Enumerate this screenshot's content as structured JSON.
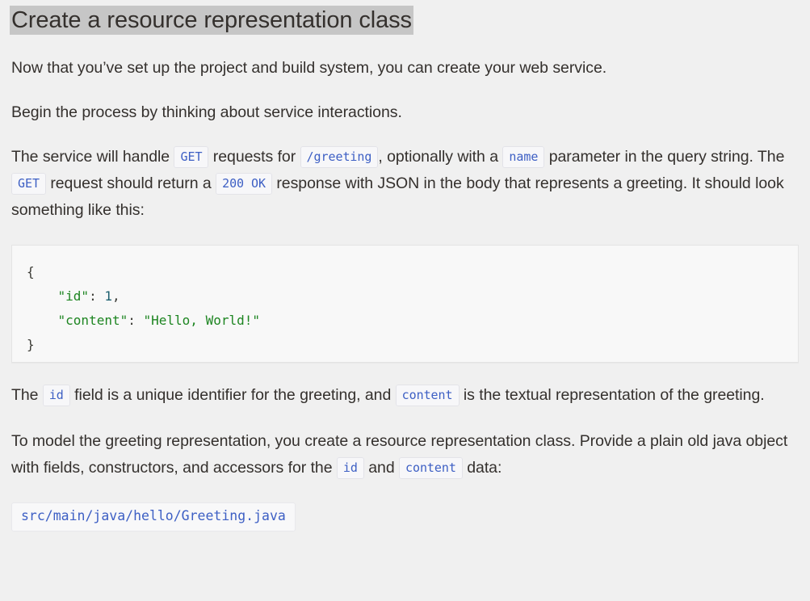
{
  "page": {
    "background_color": "#f0f0f0",
    "title": "Create a resource representation class",
    "title_highlight_color": "#c6c6c6"
  },
  "paragraphs": {
    "p1": "Now that you’ve set up the project and build system, you can create your web service.",
    "p2": "Begin the process by thinking about service interactions.",
    "p3": {
      "seg1": "The service will handle ",
      "code1": "GET",
      "seg2": " requests for ",
      "code2": "/greeting",
      "seg3": ", optionally with a ",
      "code3": "name",
      "seg4": " parameter in the query string. The ",
      "code4": "GET",
      "seg5": " request should return a ",
      "code5": "200 OK",
      "seg6": " response with JSON in the body that represents a greeting. It should look something like this:"
    },
    "p4": {
      "seg1": "The ",
      "code1": "id",
      "seg2": " field is a unique identifier for the greeting, and ",
      "code2": "content",
      "seg3": " is the textual representation of the greeting."
    },
    "p5": {
      "seg1": "To model the greeting representation, you create a resource representation class. Provide a plain old java object with fields, constructors, and accessors for the ",
      "code1": "id",
      "seg2": " and ",
      "code2": "content",
      "seg3": " data:"
    }
  },
  "code_block": {
    "language": "json",
    "line1_open": "{",
    "line2_key": "\"id\"",
    "line2_colon": ": ",
    "line2_value": "1",
    "line2_comma": ",",
    "line3_key": "\"content\"",
    "line3_colon": ": ",
    "line3_value": "\"Hello, World!\"",
    "line4_close": "}",
    "indent": "    ",
    "string_color": "#1d8521",
    "number_color": "#1a5e6e",
    "punct_color": "#3b3b35"
  },
  "filepath_chip": {
    "path": "src/main/java/hello/Greeting.java",
    "text_color": "#3d5fc4"
  }
}
